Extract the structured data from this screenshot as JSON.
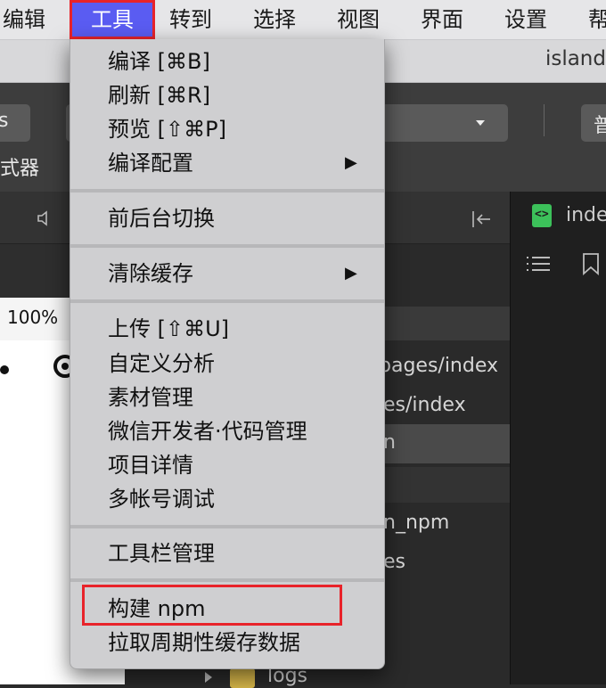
{
  "menubar": {
    "items": [
      {
        "label": "编辑"
      },
      {
        "label": "工具"
      },
      {
        "label": "转到"
      },
      {
        "label": "选择"
      },
      {
        "label": "视图"
      },
      {
        "label": "界面"
      },
      {
        "label": "设置"
      },
      {
        "label": "帮"
      }
    ]
  },
  "window": {
    "title": "island"
  },
  "toolbar": {
    "left_fragment": "s",
    "left_caption": "式器",
    "right_fragment": "普"
  },
  "simulator": {
    "zoom": "100%"
  },
  "tree": {
    "rows": [
      {
        "text": "pages/index"
      },
      {
        "text": "es/index"
      },
      {
        "text": "n"
      },
      {
        "text": "n_npm"
      },
      {
        "text": "es"
      },
      {
        "text": "logs"
      }
    ]
  },
  "editor": {
    "tab_label": "inde"
  },
  "tools_menu": {
    "items": [
      {
        "label": "编译 [⌘B]"
      },
      {
        "label": "刷新 [⌘R]"
      },
      {
        "label": "预览 [⇧⌘P]"
      },
      {
        "label": "编译配置",
        "submenu_arrow": "▶"
      },
      {
        "label": "前后台切换"
      },
      {
        "label": "清除缓存",
        "submenu_arrow": "▶"
      },
      {
        "label": "上传 [⇧⌘U]"
      },
      {
        "label": "自定义分析"
      },
      {
        "label": "素材管理"
      },
      {
        "label": "微信开发者·代码管理"
      },
      {
        "label": "项目详情"
      },
      {
        "label": "多帐号调试"
      },
      {
        "label": "工具栏管理"
      },
      {
        "label": "构建 npm"
      },
      {
        "label": "拉取周期性缓存数据"
      }
    ]
  },
  "colors": {
    "menu_highlight": "#5a5cf2",
    "annotation_red": "#e8232a",
    "file_icon_green": "#3cc15a",
    "folder_yellow": "#d9b84a"
  }
}
